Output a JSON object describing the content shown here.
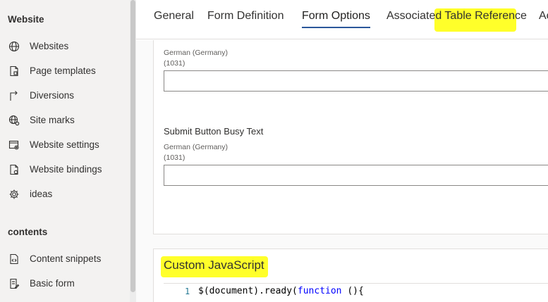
{
  "sidebar": {
    "sections": [
      {
        "label": "Website"
      },
      {
        "label": "contents"
      }
    ],
    "items": [
      {
        "label": "Websites",
        "icon": "globe-icon"
      },
      {
        "label": "Page templates",
        "icon": "page-template-icon"
      },
      {
        "label": "Diversions",
        "icon": "redirect-arrow-icon"
      },
      {
        "label": "Site marks",
        "icon": "globe-marker-icon"
      },
      {
        "label": "Website settings",
        "icon": "settings-window-icon"
      },
      {
        "label": "Website bindings",
        "icon": "binding-icon"
      },
      {
        "label": "ideas",
        "icon": "gear-icon"
      },
      {
        "label": "Content snippets",
        "icon": "snippet-icon"
      },
      {
        "label": "Basic form",
        "icon": "form-icon"
      }
    ]
  },
  "tabs": [
    {
      "label": "General"
    },
    {
      "label": "Form Definition"
    },
    {
      "label": "Form Options",
      "active": true
    },
    {
      "label": "Associated Table Reference"
    },
    {
      "label": "Ac"
    }
  ],
  "form": {
    "field1": {
      "locale": "German (Germany)",
      "code": "(1031)",
      "value": ""
    },
    "field2": {
      "label": "Submit Button Busy Text",
      "locale": "German (Germany)",
      "code": "(1031)",
      "value": ""
    }
  },
  "custom_js": {
    "title": "Custom JavaScript",
    "line_number": "1",
    "line_text_prefix": "$(document).ready(",
    "line_keyword": "function",
    "line_text_suffix": " (){"
  },
  "colors": {
    "highlight": "#ffff2a",
    "accent": "#2b579a",
    "sidebar_bg": "#f3f2f1"
  }
}
